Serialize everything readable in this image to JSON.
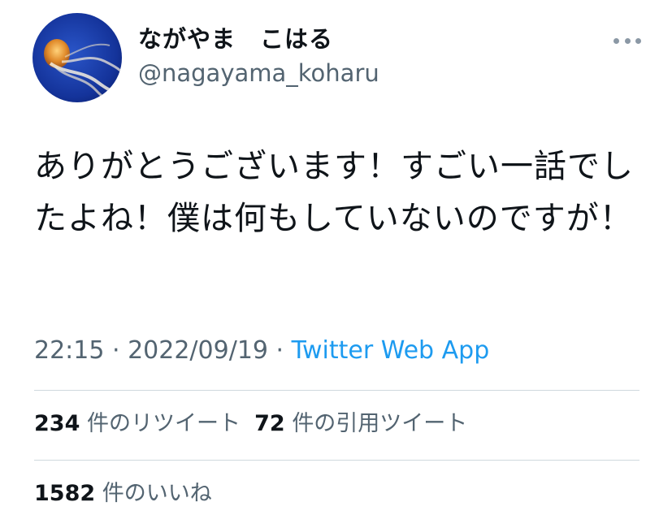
{
  "author": {
    "display_name": "ながやま　こはる",
    "handle": "@nagayama_koharu",
    "avatar_icon": "jellyfish-avatar"
  },
  "menu": {
    "icon": "more-horizontal-icon"
  },
  "tweet": {
    "text": "ありがとうございます！すごい一話でしたよね！僕は何もしていないのですが！"
  },
  "meta": {
    "time": "22:15",
    "separator": " · ",
    "date": "2022/09/19",
    "source": "Twitter Web App"
  },
  "stats": {
    "retweets_count": "234",
    "retweets_label": "件のリツイート",
    "quotes_count": "72",
    "quotes_label": "件の引用ツイート",
    "likes_count": "1582",
    "likes_label": "件のいいね"
  },
  "colors": {
    "link": "#1d9bf0",
    "secondary_text": "#536471",
    "divider": "#cfd9de"
  }
}
